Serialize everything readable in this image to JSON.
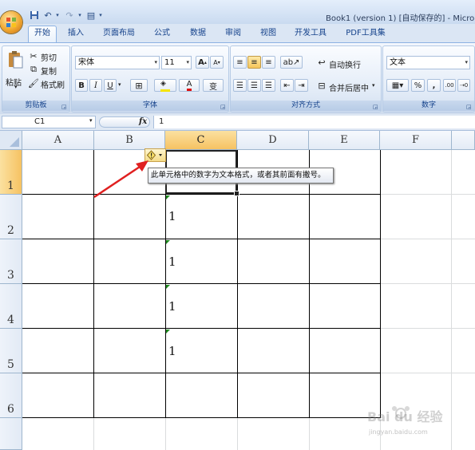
{
  "title_bar": {
    "title": "Book1 (version 1) [自动保存的] - Micro"
  },
  "tabs": [
    {
      "label": "开始",
      "active": true
    },
    {
      "label": "插入"
    },
    {
      "label": "页面布局"
    },
    {
      "label": "公式"
    },
    {
      "label": "数据"
    },
    {
      "label": "审阅"
    },
    {
      "label": "视图"
    },
    {
      "label": "开发工具"
    },
    {
      "label": "PDF工具集"
    }
  ],
  "clipboard": {
    "paste": "粘贴",
    "cut": "剪切",
    "copy": "复制",
    "format_painter": "格式刷",
    "label": "剪贴板"
  },
  "font": {
    "family": "宋体",
    "size": "11",
    "bold": "B",
    "italic": "I",
    "underline": "U",
    "grow": "A",
    "shrink": "A",
    "color_letter": "A",
    "phonetic": "变",
    "label": "字体"
  },
  "alignment": {
    "wrap_text": "自动换行",
    "merge_center": "合并后居中",
    "label": "对齐方式"
  },
  "number": {
    "format": "文本",
    "percent": "%",
    "comma": ",",
    "inc_decimal": ".00",
    "label": "数字"
  },
  "formula_bar": {
    "name_box": "C1",
    "fx": "fx",
    "content": "1"
  },
  "columns": [
    "A",
    "B",
    "C",
    "D",
    "E",
    "F"
  ],
  "rows": [
    "1",
    "2",
    "3",
    "4",
    "5",
    "6"
  ],
  "cells": [
    {
      "ref": "C2",
      "value": "1"
    },
    {
      "ref": "C3",
      "value": "1"
    },
    {
      "ref": "C4",
      "value": "1"
    },
    {
      "ref": "C5",
      "value": "1"
    }
  ],
  "error_tooltip": "此单元格中的数字为文本格式，或者其前面有撇号。",
  "watermark": {
    "brand": "Bai du 经验",
    "url": "jingyan.baidu.com"
  },
  "colors": {
    "selected_header": "#f6c262",
    "arrow": "#e02020",
    "error_triangle": "#1e8a1e"
  }
}
